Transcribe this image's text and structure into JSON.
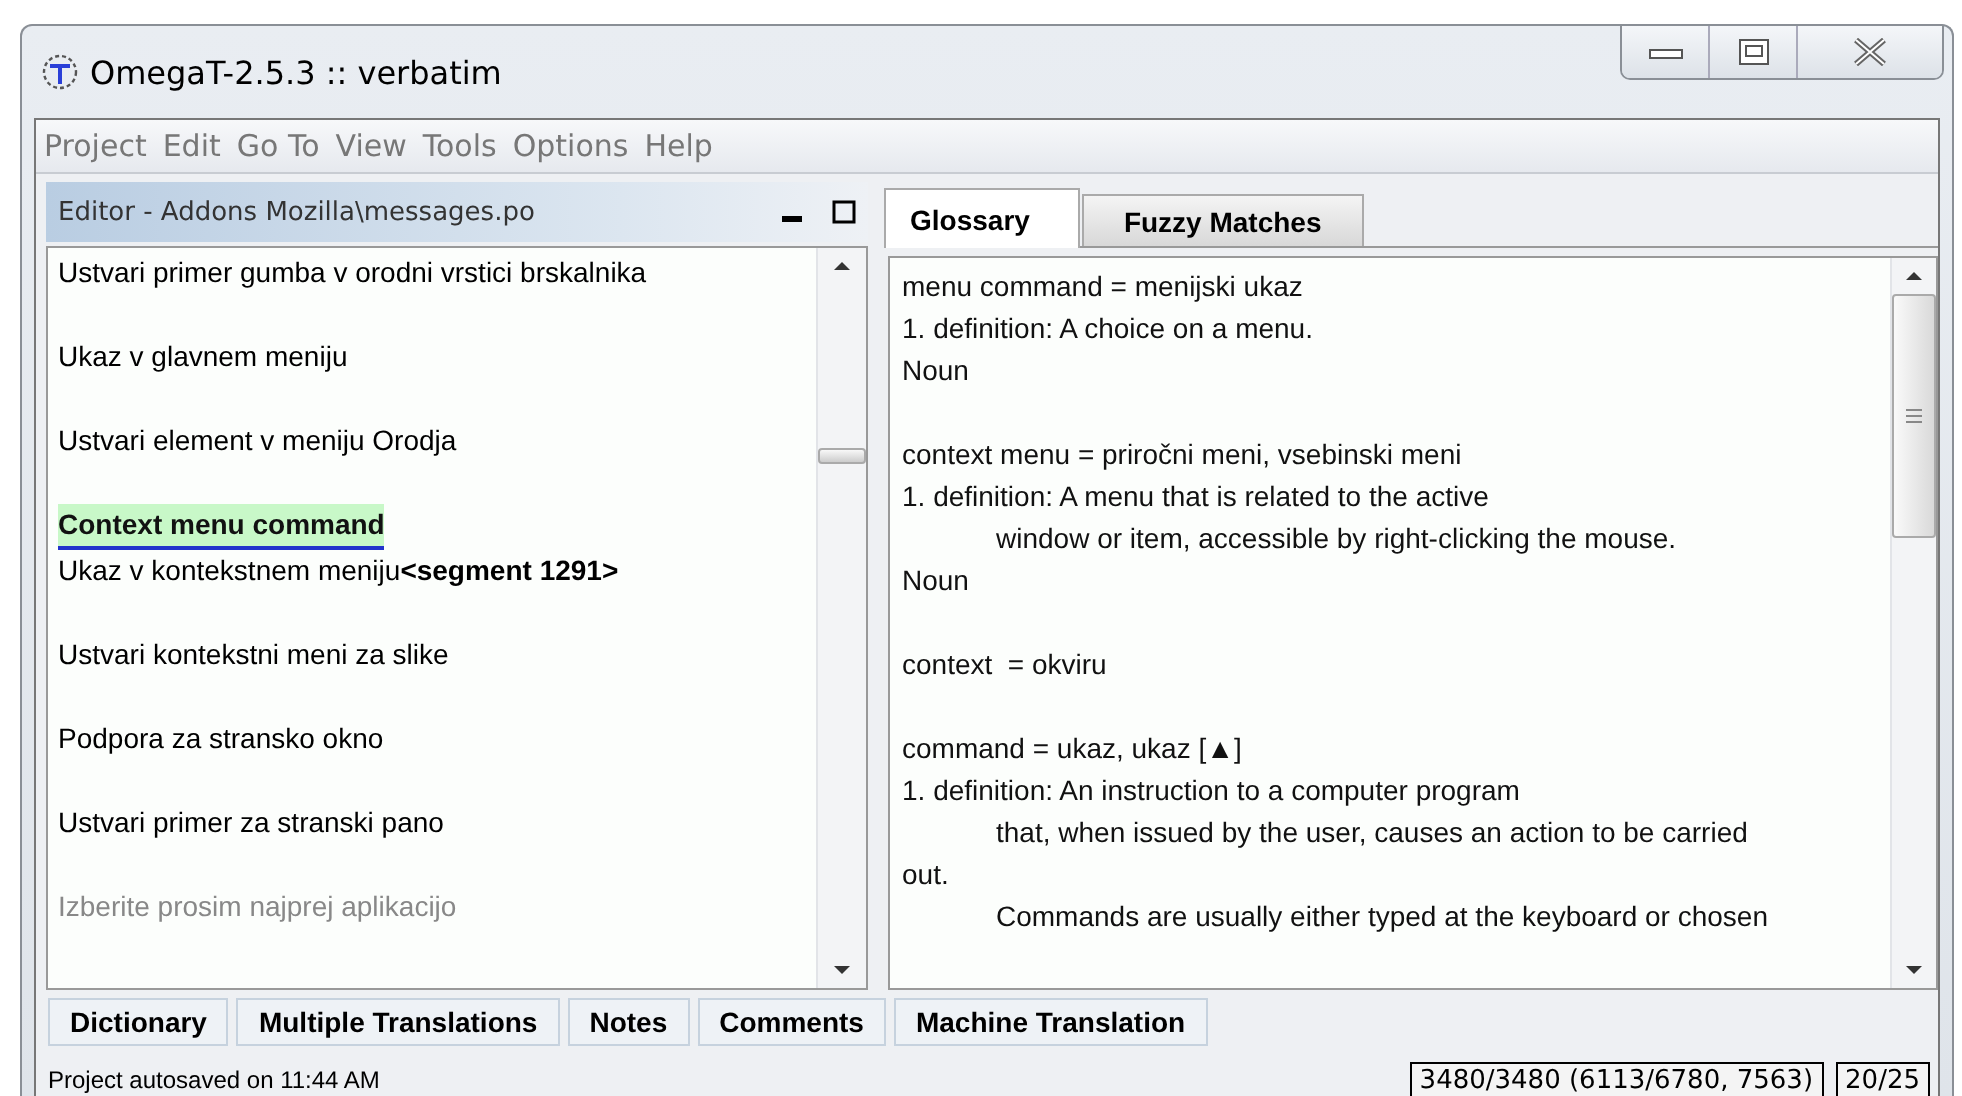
{
  "window": {
    "title": "OmegaT-2.5.3 :: verbatim"
  },
  "menu": [
    "Project",
    "Edit",
    "Go To",
    "View",
    "Tools",
    "Options",
    "Help"
  ],
  "editor": {
    "title": "Editor - Addons Mozilla\\messages.po",
    "segments": [
      {
        "kind": "plain",
        "text": "Ustvari primer gumba v orodni vrstici brskalnika"
      },
      {
        "kind": "plain",
        "text": "Ukaz v glavnem meniju"
      },
      {
        "kind": "plain",
        "text": "Ustvari element v meniju Orodja"
      },
      {
        "kind": "active",
        "source": "Context menu command",
        "text": "Ukaz v kontekstnem meniju**<segment 1291>**"
      },
      {
        "kind": "plain",
        "text": "Ustvari kontekstni meni za slike"
      },
      {
        "kind": "plain",
        "text": "Podpora za stransko okno"
      },
      {
        "kind": "plain",
        "text": "Ustvari primer za stranski pano"
      },
      {
        "kind": "greyed",
        "text": "Izberite prosim najprej aplikacijo"
      }
    ]
  },
  "tabs": [
    {
      "label": "Glossary",
      "selected": true
    },
    {
      "label": "Fuzzy Matches",
      "selected": false
    }
  ],
  "glossary": [
    {
      "lines": [
        {
          "text": "menu command = menijski ukaz",
          "indented": false
        },
        {
          "text": "1. definition: A choice on a menu.",
          "indented": false
        },
        {
          "text": "Noun",
          "indented": false
        }
      ]
    },
    {
      "lines": [
        {
          "text": "context menu = priročni meni, vsebinski meni",
          "indented": false
        },
        {
          "text": "1. definition: A menu that is related to the active",
          "indented": false
        },
        {
          "text": "window or item, accessible by right-clicking the mouse.",
          "indented": true
        },
        {
          "text": "Noun",
          "indented": false
        }
      ]
    },
    {
      "lines": [
        {
          "text": "context  = okviru",
          "indented": false
        }
      ]
    },
    {
      "lines": [
        {
          "text": "command = ukaz, ukaz [▲]",
          "indented": false
        },
        {
          "text": "1. definition: An instruction to a computer program",
          "indented": false
        },
        {
          "text": "that, when issued by the user, causes an action to be carried",
          "indented": true
        },
        {
          "text": "out.",
          "indented": false
        },
        {
          "text": "Commands are usually either typed at the keyboard or chosen",
          "indented": true
        }
      ]
    }
  ],
  "bottom_tabs": [
    "Dictionary",
    "Multiple Translations",
    "Notes",
    "Comments",
    "Machine Translation"
  ],
  "status_bar": {
    "message": "Project autosaved on 11:44 AM",
    "progress": "3480/3480 (6113/6780, 7563)",
    "count": "20/25"
  }
}
